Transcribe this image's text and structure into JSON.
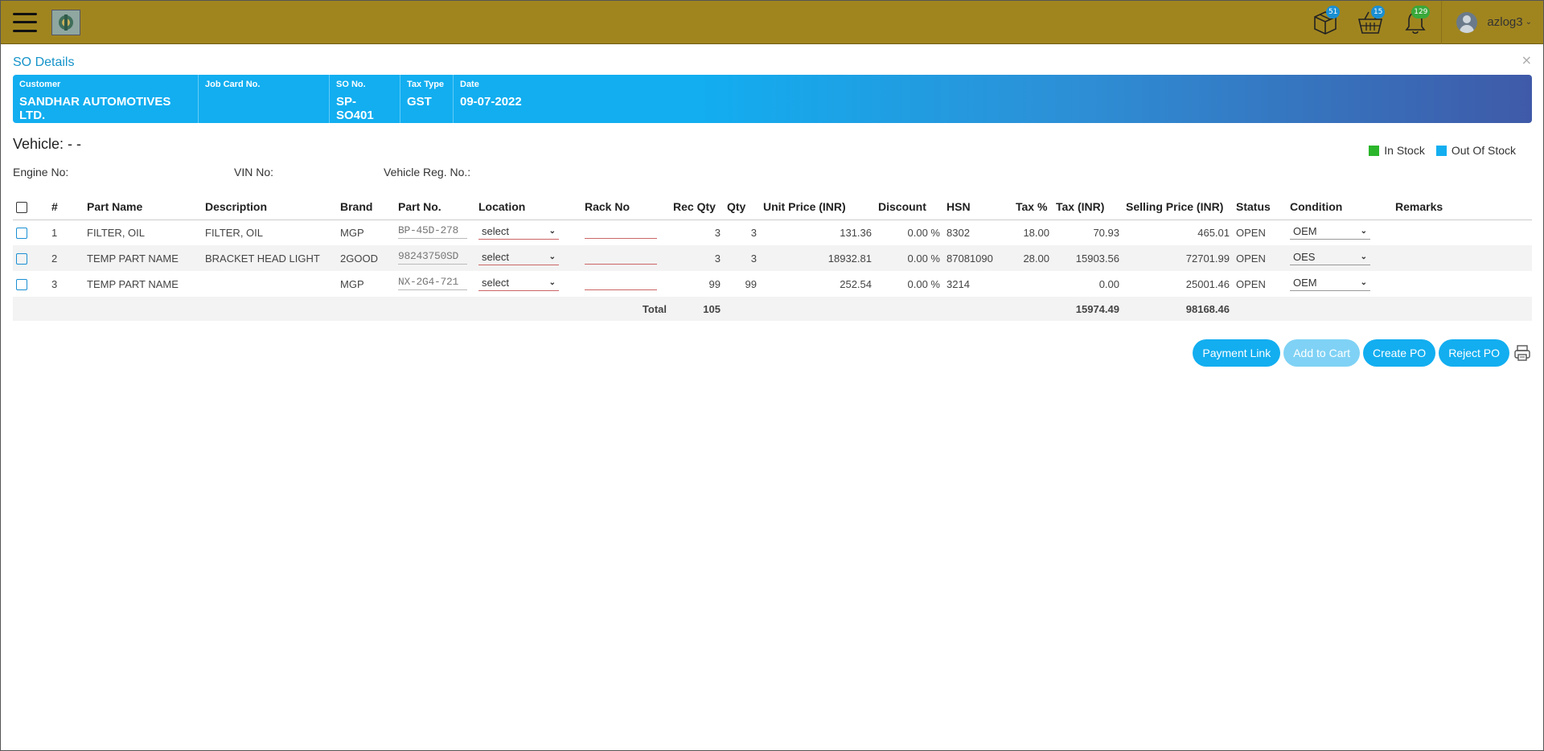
{
  "navbar": {
    "badges": {
      "box": "51",
      "cart": "15",
      "bell": "129"
    },
    "badge_colors": {
      "box": "#1a8fd3",
      "cart": "#1a8fd3",
      "bell": "#39a83a"
    },
    "user_name": "azlog3"
  },
  "page": {
    "title": "SO Details",
    "close": "×"
  },
  "info": {
    "customer": {
      "label": "Customer",
      "value": "SANDHAR AUTOMOTIVES LTD."
    },
    "job_card": {
      "label": "Job Card No.",
      "value": ""
    },
    "so_no": {
      "label": "SO No.",
      "value": "SP-SO401"
    },
    "tax_type": {
      "label": "Tax Type",
      "value": "GST"
    },
    "date": {
      "label": "Date",
      "value": "09-07-2022"
    }
  },
  "vehicle": {
    "label": "Vehicle: - -",
    "engine": "Engine No:",
    "vin": "VIN No:",
    "reg": "Vehicle Reg. No.:"
  },
  "legend": {
    "in_stock": "In Stock",
    "out_stock": "Out Of Stock",
    "in_color": "#2bb52b",
    "out_color": "#12aef0"
  },
  "table": {
    "headers": [
      "#",
      "Part Name",
      "Description",
      "Brand",
      "Part No.",
      "Location",
      "Rack No",
      "Rec Qty",
      "Qty",
      "Unit Price (INR)",
      "Discount",
      "HSN",
      "Tax %",
      "Tax (INR)",
      "Selling Price (INR)",
      "Status",
      "Condition",
      "Remarks"
    ],
    "rows": [
      {
        "num": "1",
        "part_name": "FILTER, OIL",
        "description": "FILTER, OIL",
        "brand": "MGP",
        "part_no": "BP-45D-278",
        "location": "select",
        "rec_qty": "3",
        "qty": "3",
        "unit_price": "131.36",
        "discount": "0.00 %",
        "hsn": "8302",
        "tax_pct": "18.00",
        "tax_inr": "70.93",
        "selling_price": "465.01",
        "status": "OPEN",
        "condition": "OEM"
      },
      {
        "num": "2",
        "part_name": "TEMP PART NAME",
        "description": "BRACKET HEAD LIGHT",
        "brand": "2GOOD",
        "part_no": "98243750SD",
        "location": "select",
        "rec_qty": "3",
        "qty": "3",
        "unit_price": "18932.81",
        "discount": "0.00 %",
        "hsn": "87081090",
        "tax_pct": "28.00",
        "tax_inr": "15903.56",
        "selling_price": "72701.99",
        "status": "OPEN",
        "condition": "OES"
      },
      {
        "num": "3",
        "part_name": "TEMP PART NAME",
        "description": "",
        "brand": "MGP",
        "part_no": "NX-2G4-721",
        "location": "select",
        "rec_qty": "99",
        "qty": "99",
        "unit_price": "252.54",
        "discount": "0.00 %",
        "hsn": "3214",
        "tax_pct": "",
        "tax_inr": "0.00",
        "selling_price": "25001.46",
        "status": "OPEN",
        "condition": "OEM"
      }
    ],
    "total": {
      "label": "Total",
      "qty": "105",
      "tax_inr": "15974.49",
      "selling_price": "98168.46"
    }
  },
  "buttons": {
    "payment_link": "Payment Link",
    "add_to_cart": "Add to Cart",
    "create_po": "Create PO",
    "reject_po": "Reject PO"
  }
}
